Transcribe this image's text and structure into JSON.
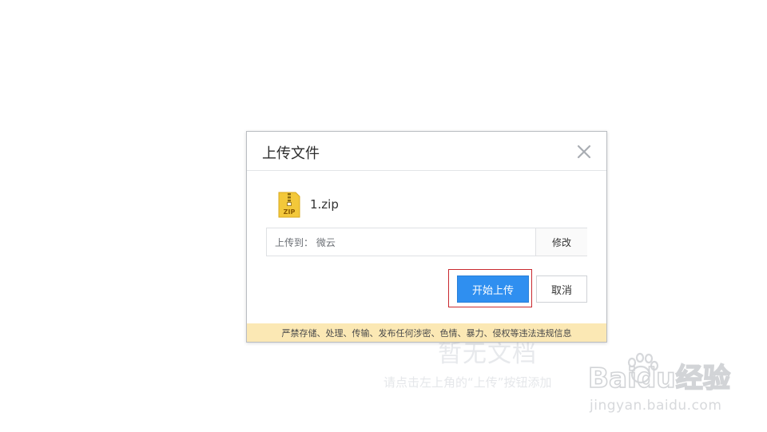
{
  "background": {
    "empty_title": "暂无文档",
    "empty_hint": "请点击左上角的“上传”按钮添加"
  },
  "watermark": {
    "logo_text": "Baidu经验",
    "url": "jingyan.baidu.com"
  },
  "dialog": {
    "title": "上传文件",
    "close_icon": "close-icon",
    "file": {
      "name": "1.zip",
      "icon": "zip-file-icon",
      "icon_label": "ZIP"
    },
    "destination": {
      "label": "上传到： 微云",
      "edit_label": "修改"
    },
    "buttons": {
      "start_label": "开始上传",
      "cancel_label": "取消"
    },
    "warning": "严禁存储、处理、传输、发布任何涉密、色情、暴力、侵权等违法违规信息"
  },
  "colors": {
    "primary": "#2f8ff0",
    "warning_bg": "#fbe8b4",
    "highlight": "#c9292f",
    "zip_icon": "#f3c83a"
  }
}
